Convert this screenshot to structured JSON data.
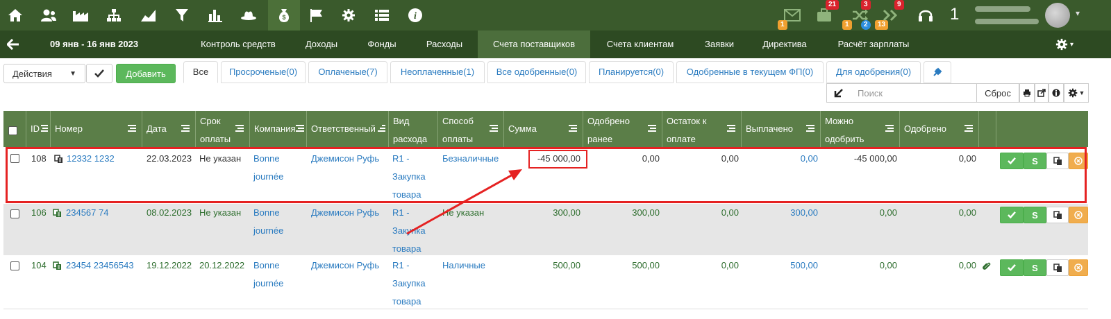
{
  "topbar": {
    "icons": [
      "home-icon",
      "users-icon",
      "factory-icon",
      "hierarchy-icon",
      "area-chart-icon",
      "filter-icon",
      "bar-chart-icon",
      "hat-icon",
      "money-bag-icon",
      "flag-icon",
      "gear-icon",
      "list-icon",
      "info-icon"
    ],
    "active_index": 8,
    "notifications": {
      "mail_badge": "1",
      "briefcase_badge": "21",
      "shuffle_badge_top": "3",
      "shuffle_badge_left": "1",
      "shuffle_badge_right": "2",
      "shuffle_badge_bottom": "13",
      "chevrons_badge": "9"
    },
    "user_count": "1"
  },
  "nav": {
    "period": "09 янв - 16 янв 2023",
    "tabs": [
      "Контроль средств",
      "Доходы",
      "Фонды",
      "Расходы",
      "Счета поставщиков",
      "Счета клиентам",
      "Заявки",
      "Директива",
      "Расчёт зарплаты"
    ],
    "active_tab": "Счета поставщиков"
  },
  "toolbar": {
    "actions_label": "Действия",
    "add_label": "Добавить",
    "filter_tabs": [
      "Все",
      "Просроченые(0)",
      "Оплаченые(7)",
      "Неоплаченные(1)",
      "Все одобренные(0)",
      "Планируется(0)",
      "Одобренные в текущем ФП(0)",
      "Для одобрения(0)"
    ],
    "search_placeholder": "Поиск",
    "reset_label": "Сброс"
  },
  "table": {
    "headers": {
      "id": "ID",
      "number": "Номер",
      "date": "Дата",
      "due": "Срок оплаты",
      "company": "Компания",
      "responsible": "Ответственный",
      "expense_type": "Вид расхода",
      "payment_method": "Способ оплаты",
      "sum": "Сумма",
      "approved_before": "Одобрено ранее",
      "remaining": "Остаток к оплате",
      "paid": "Выплачено",
      "can_approve": "Можно одобрить",
      "approved": "Одобрено"
    },
    "rows": [
      {
        "id": "108",
        "number": "12332 1232",
        "date": "22.03.2023",
        "due": "Не указан",
        "company": "Bonne journée",
        "responsible": "Джемисон Руфь",
        "expense_type": "R1 - Закупка товара",
        "payment_method": "Безналичные",
        "sum": "-45 000,00",
        "approved_before": "0,00",
        "remaining": "0,00",
        "paid": "0,00",
        "can_approve": "-45 000,00",
        "approved": "0,00"
      },
      {
        "id": "106",
        "number": "234567 74",
        "date": "08.02.2023",
        "due": "Не указан",
        "company": "Bonne journée",
        "responsible": "Джемисон Руфь",
        "expense_type": "R1 - Закупка товара",
        "payment_method": "Не указан",
        "sum": "300,00",
        "approved_before": "300,00",
        "remaining": "0,00",
        "paid": "300,00",
        "can_approve": "0,00",
        "approved": "0,00"
      },
      {
        "id": "104",
        "number": "23454 23456543",
        "date": "19.12.2022",
        "due": "20.12.2022",
        "company": "Bonne journée",
        "responsible": "Джемисон Руфь",
        "expense_type": "R1 - Закупка товара",
        "payment_method": "Наличные",
        "sum": "500,00",
        "approved_before": "500,00",
        "remaining": "0,00",
        "paid": "500,00",
        "can_approve": "0,00",
        "approved": "0,00"
      }
    ],
    "row_action_s_label": "S"
  },
  "colors": {
    "topbar": "#3a5a2c",
    "navbar": "#2d4a22",
    "table_header": "#5b7e48",
    "link": "#2a7bc0",
    "green_text": "#2e6e2e",
    "annotation": "#e52222"
  }
}
